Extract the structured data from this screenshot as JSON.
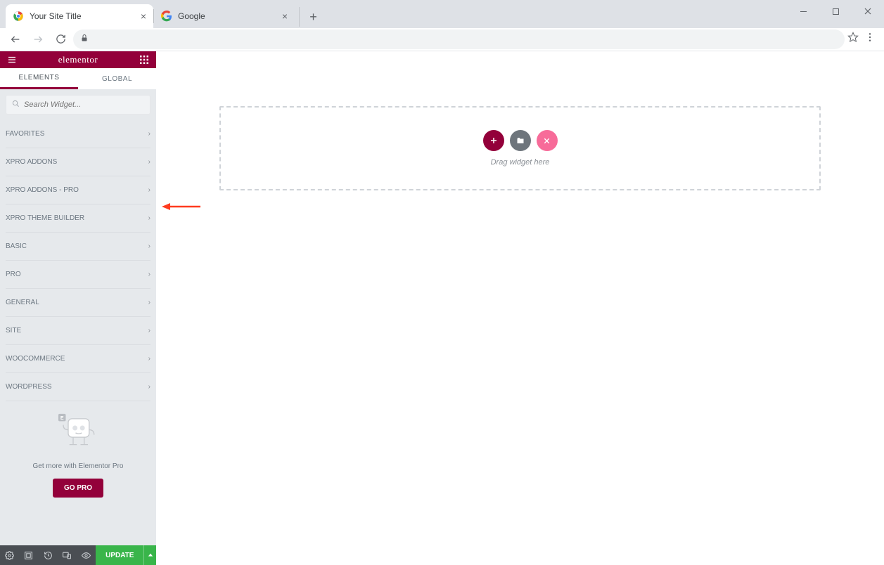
{
  "browser": {
    "tabs": [
      {
        "title": "Your Site Title",
        "active": true
      },
      {
        "title": "Google",
        "active": false
      }
    ]
  },
  "sidebar": {
    "brand": "elementor",
    "tabs": {
      "elements": "ELEMENTS",
      "global": "GLOBAL"
    },
    "search_placeholder": "Search Widget...",
    "categories": [
      "FAVORITES",
      "XPRO ADDONS",
      "XPRO ADDONS - PRO",
      "XPRO THEME BUILDER",
      "BASIC",
      "PRO",
      "GENERAL",
      "SITE",
      "WOOCOMMERCE",
      "WORDPRESS"
    ],
    "promo_text": "Get more with Elementor Pro",
    "go_pro_label": "GO PRO"
  },
  "footer": {
    "update_label": "UPDATE"
  },
  "canvas": {
    "drop_text": "Drag widget here",
    "btn_colors": {
      "plus": "#93003a",
      "folder": "#6e757c",
      "x": "#f76b99"
    }
  }
}
